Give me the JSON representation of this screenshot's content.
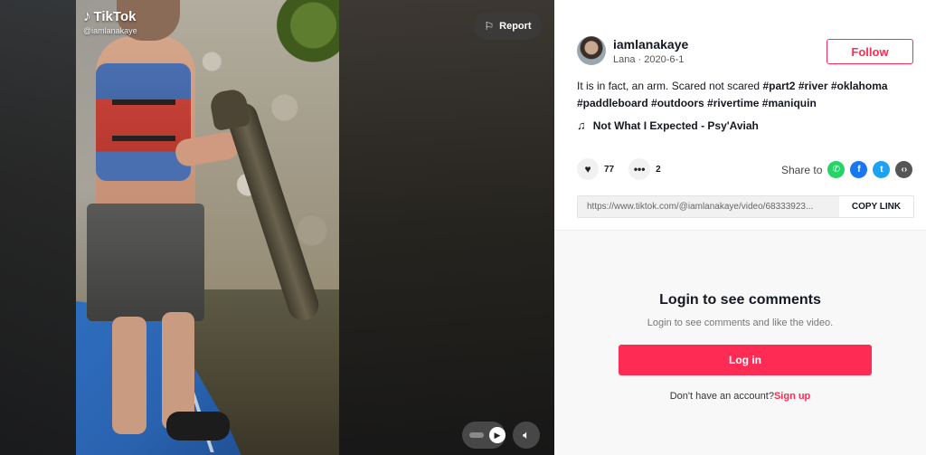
{
  "brand": {
    "logo_text": "TikTok",
    "handle_watermark": "@iamlanakaye",
    "accent_color": "#fe2c55"
  },
  "video": {
    "report_label": "Report"
  },
  "author": {
    "username": "iamlanakaye",
    "nickname": "Lana",
    "date": "2020-6-1",
    "follow_label": "Follow"
  },
  "caption": {
    "text": "It is in fact, an arm. Scared not scared",
    "hashtags": [
      "#part2",
      "#river",
      "#oklahoma",
      "#paddleboard",
      "#outdoors",
      "#rivertime",
      "#maniquin"
    ]
  },
  "music": {
    "title": "Not What I Expected - Psy'Aviah"
  },
  "stats": {
    "likes": "77",
    "comments": "2"
  },
  "share": {
    "label": "Share to",
    "targets": [
      "whatsapp-icon",
      "facebook-icon",
      "twitter-icon",
      "embed-icon"
    ]
  },
  "link": {
    "url": "https://www.tiktok.com/@iamlanakaye/video/68333923...",
    "copy_label": "COPY LINK"
  },
  "comments": {
    "title": "Login to see comments",
    "subtitle": "Login to see comments and like the video.",
    "login_label": "Log in",
    "no_account": "Don't have an account?",
    "signup_label": "Sign up"
  }
}
